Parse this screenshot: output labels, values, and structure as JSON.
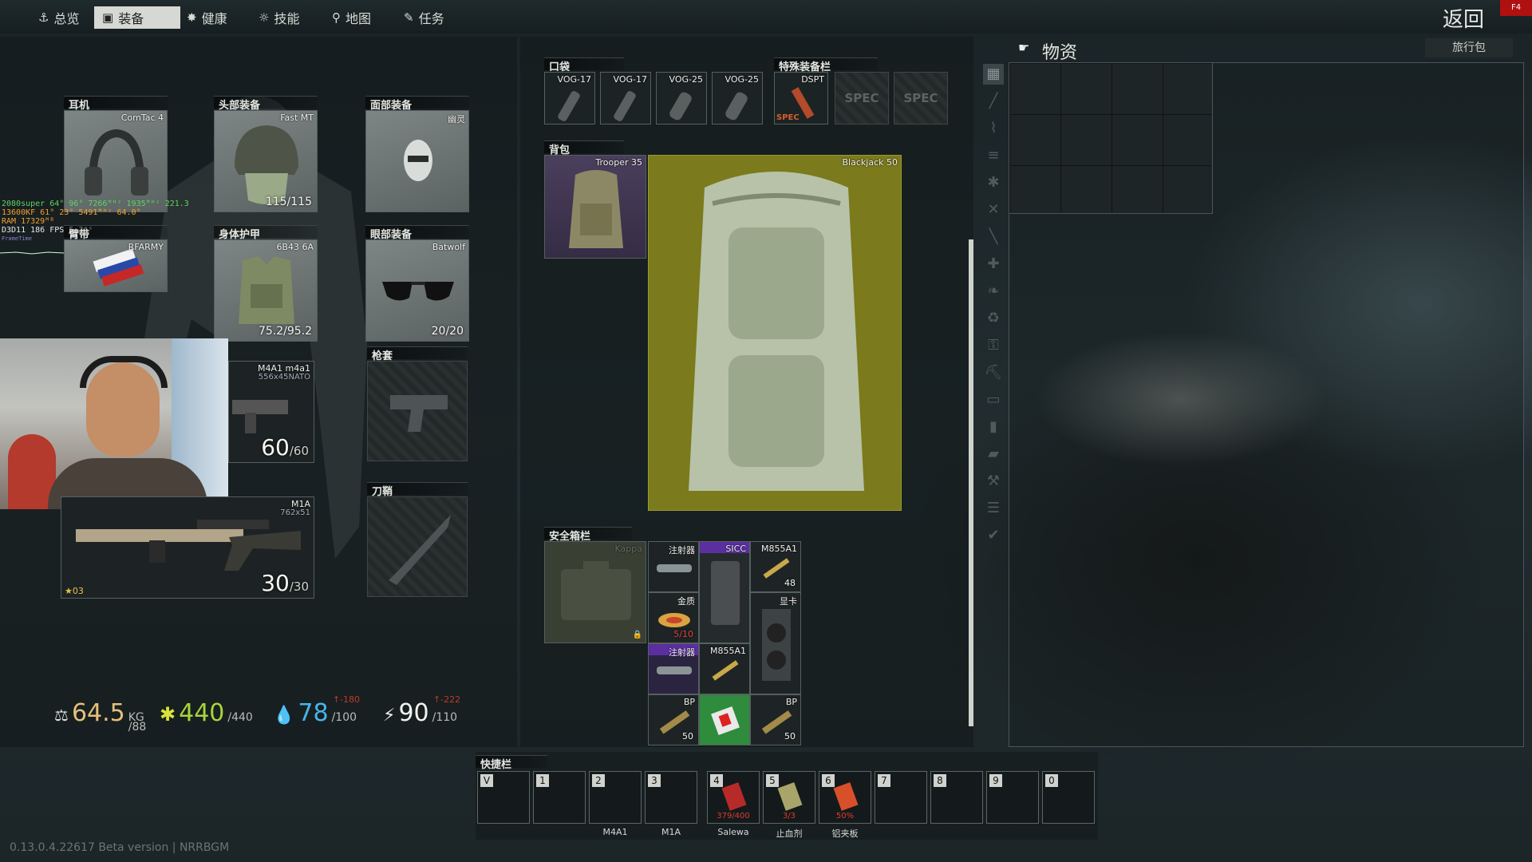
{
  "nav": {
    "tabs": [
      {
        "label": "总览",
        "icon": "person-icon"
      },
      {
        "label": "装备",
        "icon": "gear-vest-icon"
      },
      {
        "label": "健康",
        "icon": "health-icon"
      },
      {
        "label": "技能",
        "icon": "skills-icon"
      },
      {
        "label": "地图",
        "icon": "map-pin-icon"
      },
      {
        "label": "任务",
        "icon": "task-icon"
      }
    ],
    "back_label": "返回",
    "corner_badge": "F4"
  },
  "equipment": {
    "headset": {
      "header": "耳机",
      "item": "ComTac 4"
    },
    "headwear": {
      "header": "头部装备",
      "item": "Fast MT",
      "durability": "115/115"
    },
    "face": {
      "header": "面部装备",
      "item": "幽灵"
    },
    "armband": {
      "header": "臂带",
      "item": "RFARMY"
    },
    "body_armor": {
      "header": "身体护甲",
      "item": "6B43 6A",
      "durability": "75.2/95.2"
    },
    "eyewear": {
      "header": "眼部装备",
      "item": "Batwolf",
      "durability": "20/20"
    },
    "primary_1": {
      "item": "M4A1 m4a1",
      "caliber": "556x45NATO",
      "ammo": "60",
      "ammo_max": "/60"
    },
    "holster": {
      "header": "枪套"
    },
    "primary_2": {
      "item": "M1A",
      "caliber": "762x51",
      "ammo": "30",
      "ammo_max": "/30",
      "rank": "03"
    },
    "scabbard": {
      "header": "刀鞘"
    }
  },
  "hud_overlay": {
    "lines": [
      "2080super   64°   96°  7266ᴹᴴᶻ 1935ᴹᴴᶻ 221.3",
      "13600KF    61°   23°  5491ᴹᴴᶻ  64.0°",
      "RAM     17329ᴹᴮ",
      "D3D11    186 FPS   5.3ᵐˢ",
      "FrameTime"
    ]
  },
  "pockets": {
    "header": "口袋",
    "items": [
      "VOG-17",
      "VOG-17",
      "VOG-25",
      "VOG-25"
    ]
  },
  "special": {
    "header": "特殊装备栏",
    "items": [
      {
        "label": "DSPT",
        "tag": "SPEC"
      },
      {
        "label": "SPEC"
      },
      {
        "label": "SPEC"
      }
    ]
  },
  "backpack": {
    "header": "背包",
    "slot_item": "Trooper 35",
    "preview_item": "Blackjack 50"
  },
  "secure": {
    "header": "安全箱栏",
    "container": "Kappa",
    "items": [
      {
        "label": "注射器"
      },
      {
        "label": "SICC"
      },
      {
        "label": "M855A1",
        "count": "48"
      },
      {
        "label": "金质",
        "count": "5/10"
      },
      {
        "label": "显卡"
      },
      {
        "label": "注射器"
      },
      {
        "label": "M855A1"
      },
      {
        "label": "BP",
        "count": "50"
      },
      {
        "label": "BP",
        "count": "50"
      }
    ]
  },
  "stash": {
    "title": "物资",
    "right_label": "旅行包"
  },
  "stats": {
    "weight": "64.5",
    "weight_unit": "KG",
    "weight_max": "/88",
    "health": "440",
    "health_max": "/440",
    "hydration": "78",
    "hydration_max": "/100",
    "hydration_rate": "↑-180",
    "energy": "90",
    "energy_max": "/110",
    "energy_rate": "↑-222"
  },
  "quickbar": {
    "header": "快捷栏",
    "slots": [
      {
        "key": "V",
        "label": ""
      },
      {
        "key": "1",
        "label": ""
      },
      {
        "key": "2",
        "label": "M4A1"
      },
      {
        "key": "3",
        "label": "M1A"
      },
      {
        "key": "4",
        "label": "Salewa",
        "value": "379/400"
      },
      {
        "key": "5",
        "label": "止血剂",
        "value": "3/3"
      },
      {
        "key": "6",
        "label": "铝夹板",
        "value": "50%"
      },
      {
        "key": "7",
        "label": ""
      },
      {
        "key": "8",
        "label": ""
      },
      {
        "key": "9",
        "label": ""
      },
      {
        "key": "0",
        "label": ""
      }
    ]
  },
  "version": "0.13.0.4.22617 Beta version | NRRBGM",
  "colors": {
    "accent": "#d6d8d3",
    "hydration": "#46b6e8",
    "health": "#a7d43b",
    "energy": "#ffffff",
    "negative": "#c0392b",
    "backpack_bg": "#7b7a1c"
  }
}
